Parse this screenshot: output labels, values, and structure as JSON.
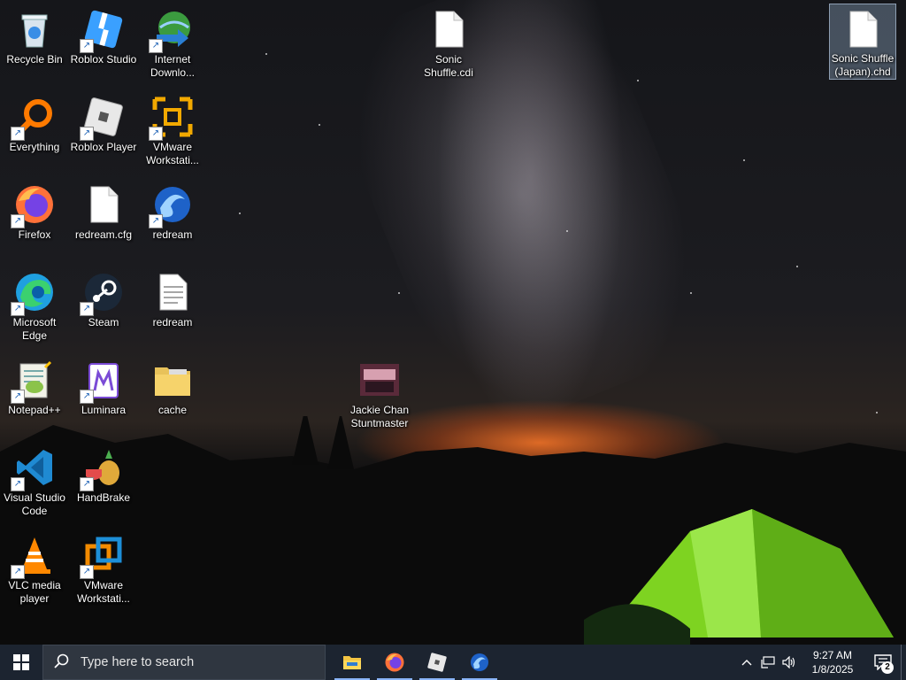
{
  "desktop": {
    "icons": [
      {
        "label": "Recycle Bin",
        "icon": "recycle-bin-icon"
      },
      {
        "label": "Roblox Studio",
        "icon": "roblox-studio-icon"
      },
      {
        "label": "Internet Downlo...",
        "icon": "internet-download-manager-icon"
      },
      {
        "label": "Everything",
        "icon": "everything-search-icon"
      },
      {
        "label": "Roblox Player",
        "icon": "roblox-player-icon"
      },
      {
        "label": "VMware Workstati...",
        "icon": "vmware-workstation-icon"
      },
      {
        "label": "Firefox",
        "icon": "firefox-icon"
      },
      {
        "label": "redream.cfg",
        "icon": "file-icon"
      },
      {
        "label": "redream",
        "icon": "redream-icon"
      },
      {
        "label": "Microsoft Edge",
        "icon": "edge-icon"
      },
      {
        "label": "Steam",
        "icon": "steam-icon"
      },
      {
        "label": "redream",
        "icon": "text-file-icon"
      },
      {
        "label": "Notepad++",
        "icon": "notepad-plus-plus-icon"
      },
      {
        "label": "Luminara",
        "icon": "luminara-icon"
      },
      {
        "label": "cache",
        "icon": "folder-icon"
      },
      {
        "label": "Visual Studio Code",
        "icon": "vscode-icon"
      },
      {
        "label": "HandBrake",
        "icon": "handbrake-icon"
      },
      {
        "label": "VLC media player",
        "icon": "vlc-icon"
      },
      {
        "label": "VMware Workstati...",
        "icon": "vmware-workstation-icon"
      },
      {
        "label": "Sonic Shuffle.cdi",
        "icon": "file-icon"
      },
      {
        "label": "Sonic Shuffle (Japan).chd",
        "icon": "file-icon"
      },
      {
        "label": "Jackie Chan Stuntmaster",
        "icon": "game-cover-icon"
      }
    ]
  },
  "taskbar": {
    "search_placeholder": "Type here to search",
    "apps": [
      {
        "icon": "file-explorer-icon"
      },
      {
        "icon": "firefox-icon"
      },
      {
        "icon": "roblox-player-icon"
      },
      {
        "icon": "redream-icon"
      }
    ],
    "clock": {
      "time": "9:27 AM",
      "date": "1/8/2025"
    },
    "notification_count": "2"
  },
  "colors": {
    "taskbar_bg": "#1c2430",
    "active_indicator": "#8ab4f8",
    "tent_green": "#7ed321"
  }
}
